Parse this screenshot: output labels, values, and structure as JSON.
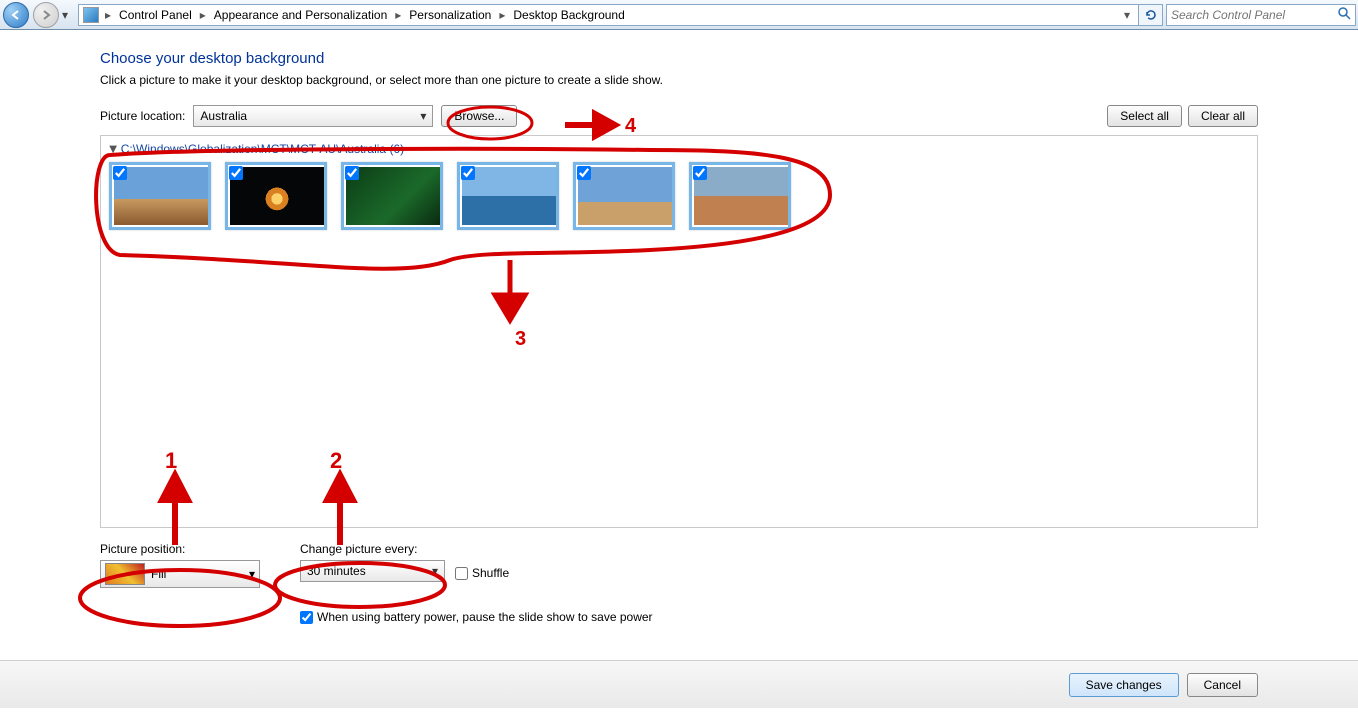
{
  "breadcrumb": {
    "items": [
      "Control Panel",
      "Appearance and Personalization",
      "Personalization",
      "Desktop Background"
    ]
  },
  "search": {
    "placeholder": "Search Control Panel"
  },
  "heading": "Choose your desktop background",
  "subtext": "Click a picture to make it your desktop background, or select more than one picture to create a slide show.",
  "picture_location": {
    "label": "Picture location:",
    "value": "Australia",
    "browse": "Browse..."
  },
  "buttons": {
    "select_all": "Select all",
    "clear_all": "Clear all",
    "save": "Save changes",
    "cancel": "Cancel"
  },
  "group": {
    "path": "C:\\Windows\\Globalization\\MCT\\MCT-AU\\Australia (6)"
  },
  "thumbs": [
    {
      "checked": true
    },
    {
      "checked": true
    },
    {
      "checked": true
    },
    {
      "checked": true
    },
    {
      "checked": true
    },
    {
      "checked": true
    }
  ],
  "position": {
    "label": "Picture position:",
    "value": "Fill"
  },
  "interval": {
    "label": "Change picture every:",
    "value": "30 minutes"
  },
  "shuffle": {
    "label": "Shuffle",
    "checked": false
  },
  "battery": {
    "label": "When using battery power, pause the slide show to save power",
    "checked": true
  },
  "annotations": {
    "n1": "1",
    "n2": "2",
    "n3": "3",
    "n4": "4"
  }
}
